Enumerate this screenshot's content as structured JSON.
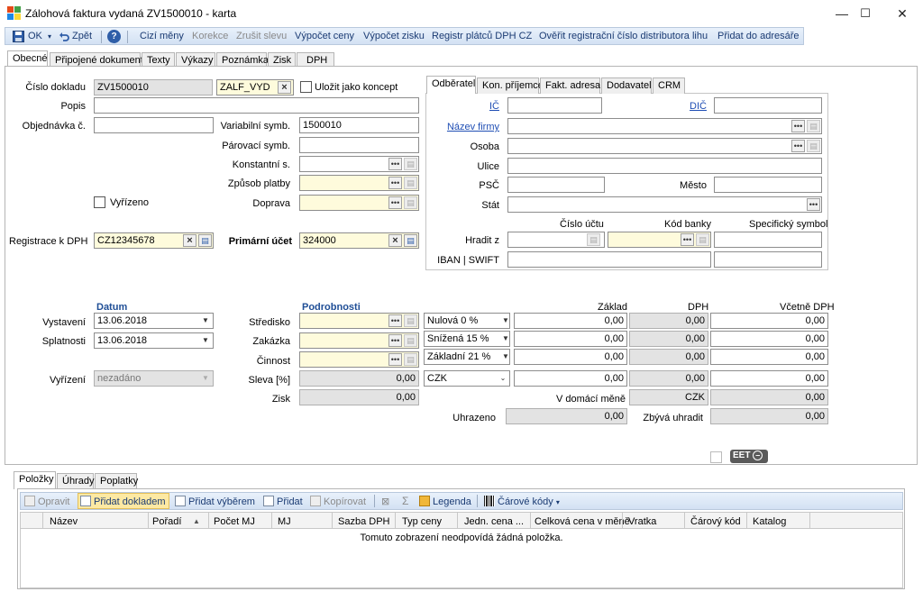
{
  "window": {
    "title": "Zálohová faktura vydaná ZV1500010 - karta",
    "controls": [
      "—",
      "☐",
      "✕"
    ]
  },
  "toolbar": {
    "ok": "OK",
    "back": "Zpět",
    "help": "?",
    "items": [
      "Cizí měny",
      "Korekce",
      "Zrušit slevu",
      "Výpočet ceny",
      "Výpočet zisku",
      "Registr plátců DPH CZ",
      "Ověřit registrační číslo distributora lihu",
      "Přidat do adresáře"
    ],
    "enabled": [
      true,
      false,
      false,
      true,
      true,
      true,
      true,
      true
    ]
  },
  "main_tabs": [
    "Obecné",
    "Připojené dokumenty",
    "Texty",
    "Výkazy",
    "Poznámka",
    "Zisk",
    "DPH"
  ],
  "form": {
    "cislo_dokladu_label": "Číslo dokladu",
    "cislo_dokladu": "ZV1500010",
    "rada": "ZALF_VYD",
    "ulozit_label": "Uložit jako koncept",
    "popis_label": "Popis",
    "popis": "",
    "objednavka_label": "Objednávka č.",
    "objednavka": "",
    "variabilni_label": "Variabilní symb.",
    "variabilni": "1500010",
    "parovaci_label": "Párovací symb.",
    "parovaci": "",
    "konstantni_label": "Konstantní s.",
    "zpusob_label": "Způsob platby",
    "doprava_label": "Doprava",
    "vyrizeno_label": "Vyřízeno",
    "registrace_label": "Registrace k DPH",
    "registrace": "CZ12345678",
    "primarni_label": "Primární účet",
    "primarni": "324000"
  },
  "partner": {
    "tabs": [
      "Odběratel",
      "Kon. příjemce",
      "Fakt. adresa",
      "Dodavatel",
      "CRM"
    ],
    "ic_label": "IČ",
    "dic_label": "DIČ",
    "nazev_label": "Název firmy",
    "osoba_label": "Osoba",
    "ulice_label": "Ulice",
    "psc_label": "PSČ",
    "mesto_label": "Město",
    "stat_label": "Stát",
    "cislo_uctu_label": "Číslo účtu",
    "kod_banky_label": "Kód banky",
    "spec_symbol_label": "Specifický symbol",
    "hradit_label": "Hradit z",
    "iban_label": "IBAN | SWIFT"
  },
  "dates": {
    "header": "Datum",
    "vystaveni_label": "Vystavení",
    "vystaveni": "13.06.2018",
    "splatnost_label": "Splatnosti",
    "splatnost": "13.06.2018",
    "vyrizeni_label": "Vyřízení",
    "vyrizeni": "nezadáno"
  },
  "details": {
    "header": "Podrobnosti",
    "stredisko_label": "Středisko",
    "zakazka_label": "Zakázka",
    "cinnost_label": "Činnost",
    "sleva_label": "Sleva [%]",
    "sleva": "0,00",
    "zisk_label": "Zisk",
    "zisk": "0,00"
  },
  "vat": {
    "zaklad_h": "Základ",
    "dph_h": "DPH",
    "vcetne_h": "Včetně DPH",
    "rows": [
      {
        "rate": "Nulová 0 %",
        "zaklad": "0,00",
        "dph": "0,00",
        "vcetne": "0,00"
      },
      {
        "rate": "Snížená 15 %",
        "zaklad": "0,00",
        "dph": "0,00",
        "vcetne": "0,00"
      },
      {
        "rate": "Základní 21 %",
        "zaklad": "0,00",
        "dph": "0,00",
        "vcetne": "0,00"
      }
    ],
    "currency": "CZK",
    "total_zaklad": "0,00",
    "total_dph": "0,00",
    "total_vcetne": "0,00",
    "domaci_label": "V domácí měně",
    "domaci_mena": "CZK",
    "domaci_vcetne": "0,00",
    "uhrazeno_label": "Uhrazeno",
    "uhrazeno": "0,00",
    "zbyva_label": "Zbývá uhradit",
    "zbyva": "0,00"
  },
  "eet_label": "EET",
  "bottom_tabs": [
    "Položky",
    "Úhrady",
    "Poplatky"
  ],
  "grid_toolbar": {
    "items": [
      "Opravit",
      "Přidat dokladem",
      "Přidat výběrem",
      "Přidat",
      "Kopírovat",
      "Legenda",
      "Čárové kódy"
    ],
    "sigma": "Σ"
  },
  "grid": {
    "columns": [
      "Název",
      "Pořadí",
      "Počet MJ",
      "MJ",
      "Sazba DPH",
      "Typ ceny",
      "Jedn. cena ...",
      "Celková cena v měně",
      "Vratka",
      "Čárový kód",
      "Katalog"
    ],
    "empty": "Tomuto zobrazení neodpovídá žádná položka."
  },
  "colors": {
    "accent": "#1f4e96",
    "highlight_yellow": "#fefbdc",
    "toolbar": "#dbe6f4"
  }
}
